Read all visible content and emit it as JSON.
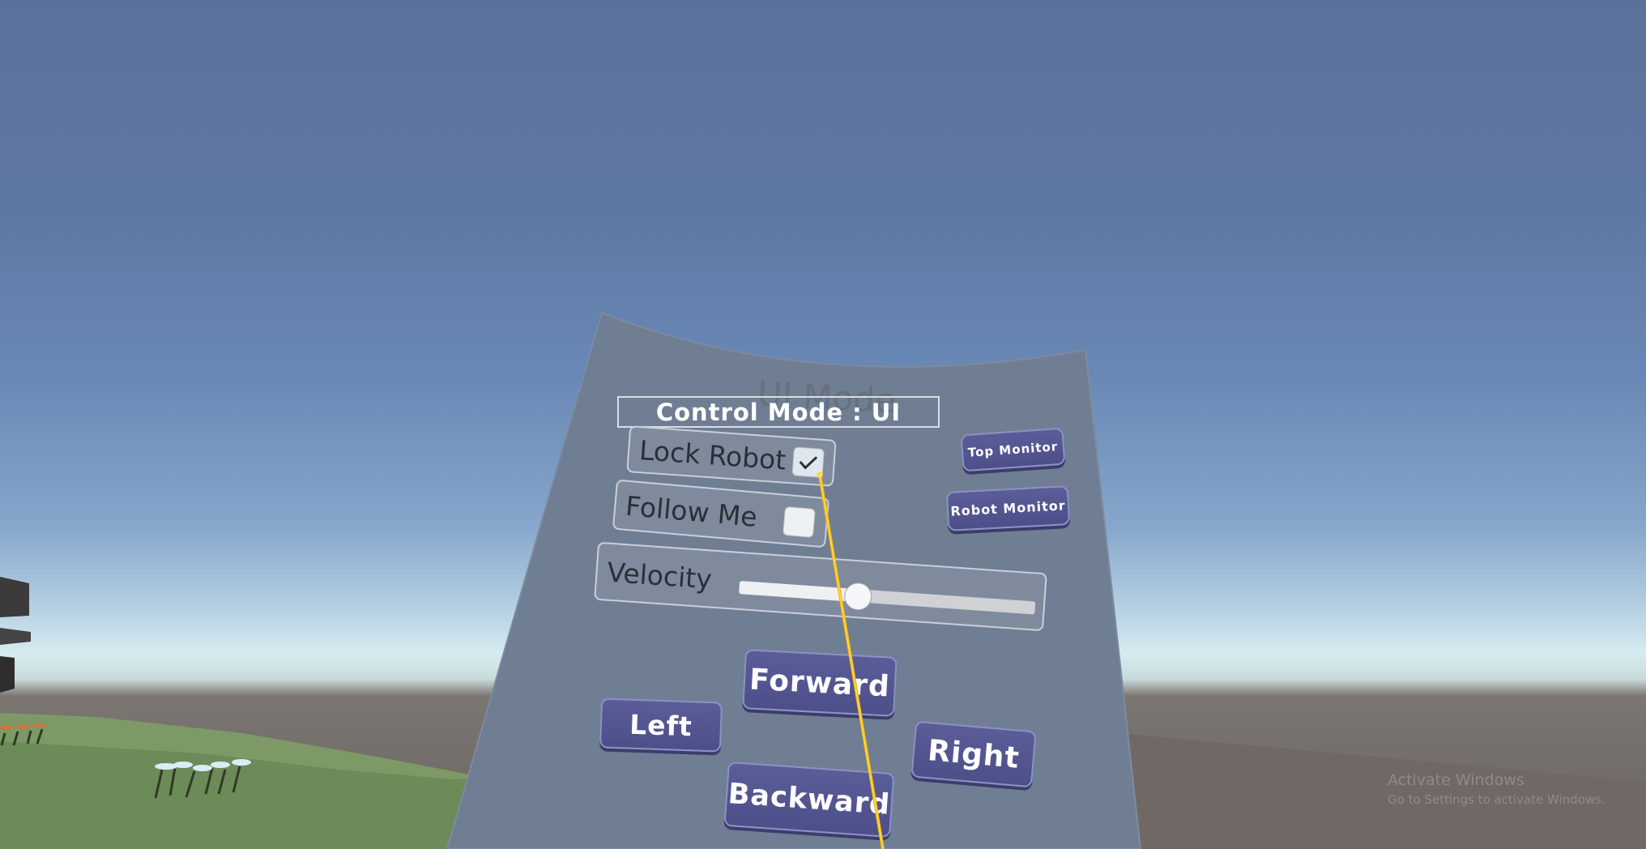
{
  "panel": {
    "title": "Control Mode : UI",
    "ghost_title": "UI Mode",
    "lock_robot": {
      "label": "Lock Robot",
      "checked": true
    },
    "follow_me": {
      "label": "Follow Me",
      "checked": false
    },
    "velocity": {
      "label": "Velocity",
      "value": 0.4
    }
  },
  "buttons": {
    "top_monitor": "Top Monitor",
    "robot_monitor": "Robot Monitor",
    "forward": "Forward",
    "left": "Left",
    "right": "Right",
    "backward": "Backward"
  },
  "watermark": {
    "title": "Activate Windows",
    "subtitle": "Go to Settings to activate Windows."
  },
  "colors": {
    "sky_top": "#5b719b",
    "horizon": "#d7ecf0",
    "panel": "#6f7e93",
    "button": "#4f518c",
    "laser": "#f2b90a"
  }
}
